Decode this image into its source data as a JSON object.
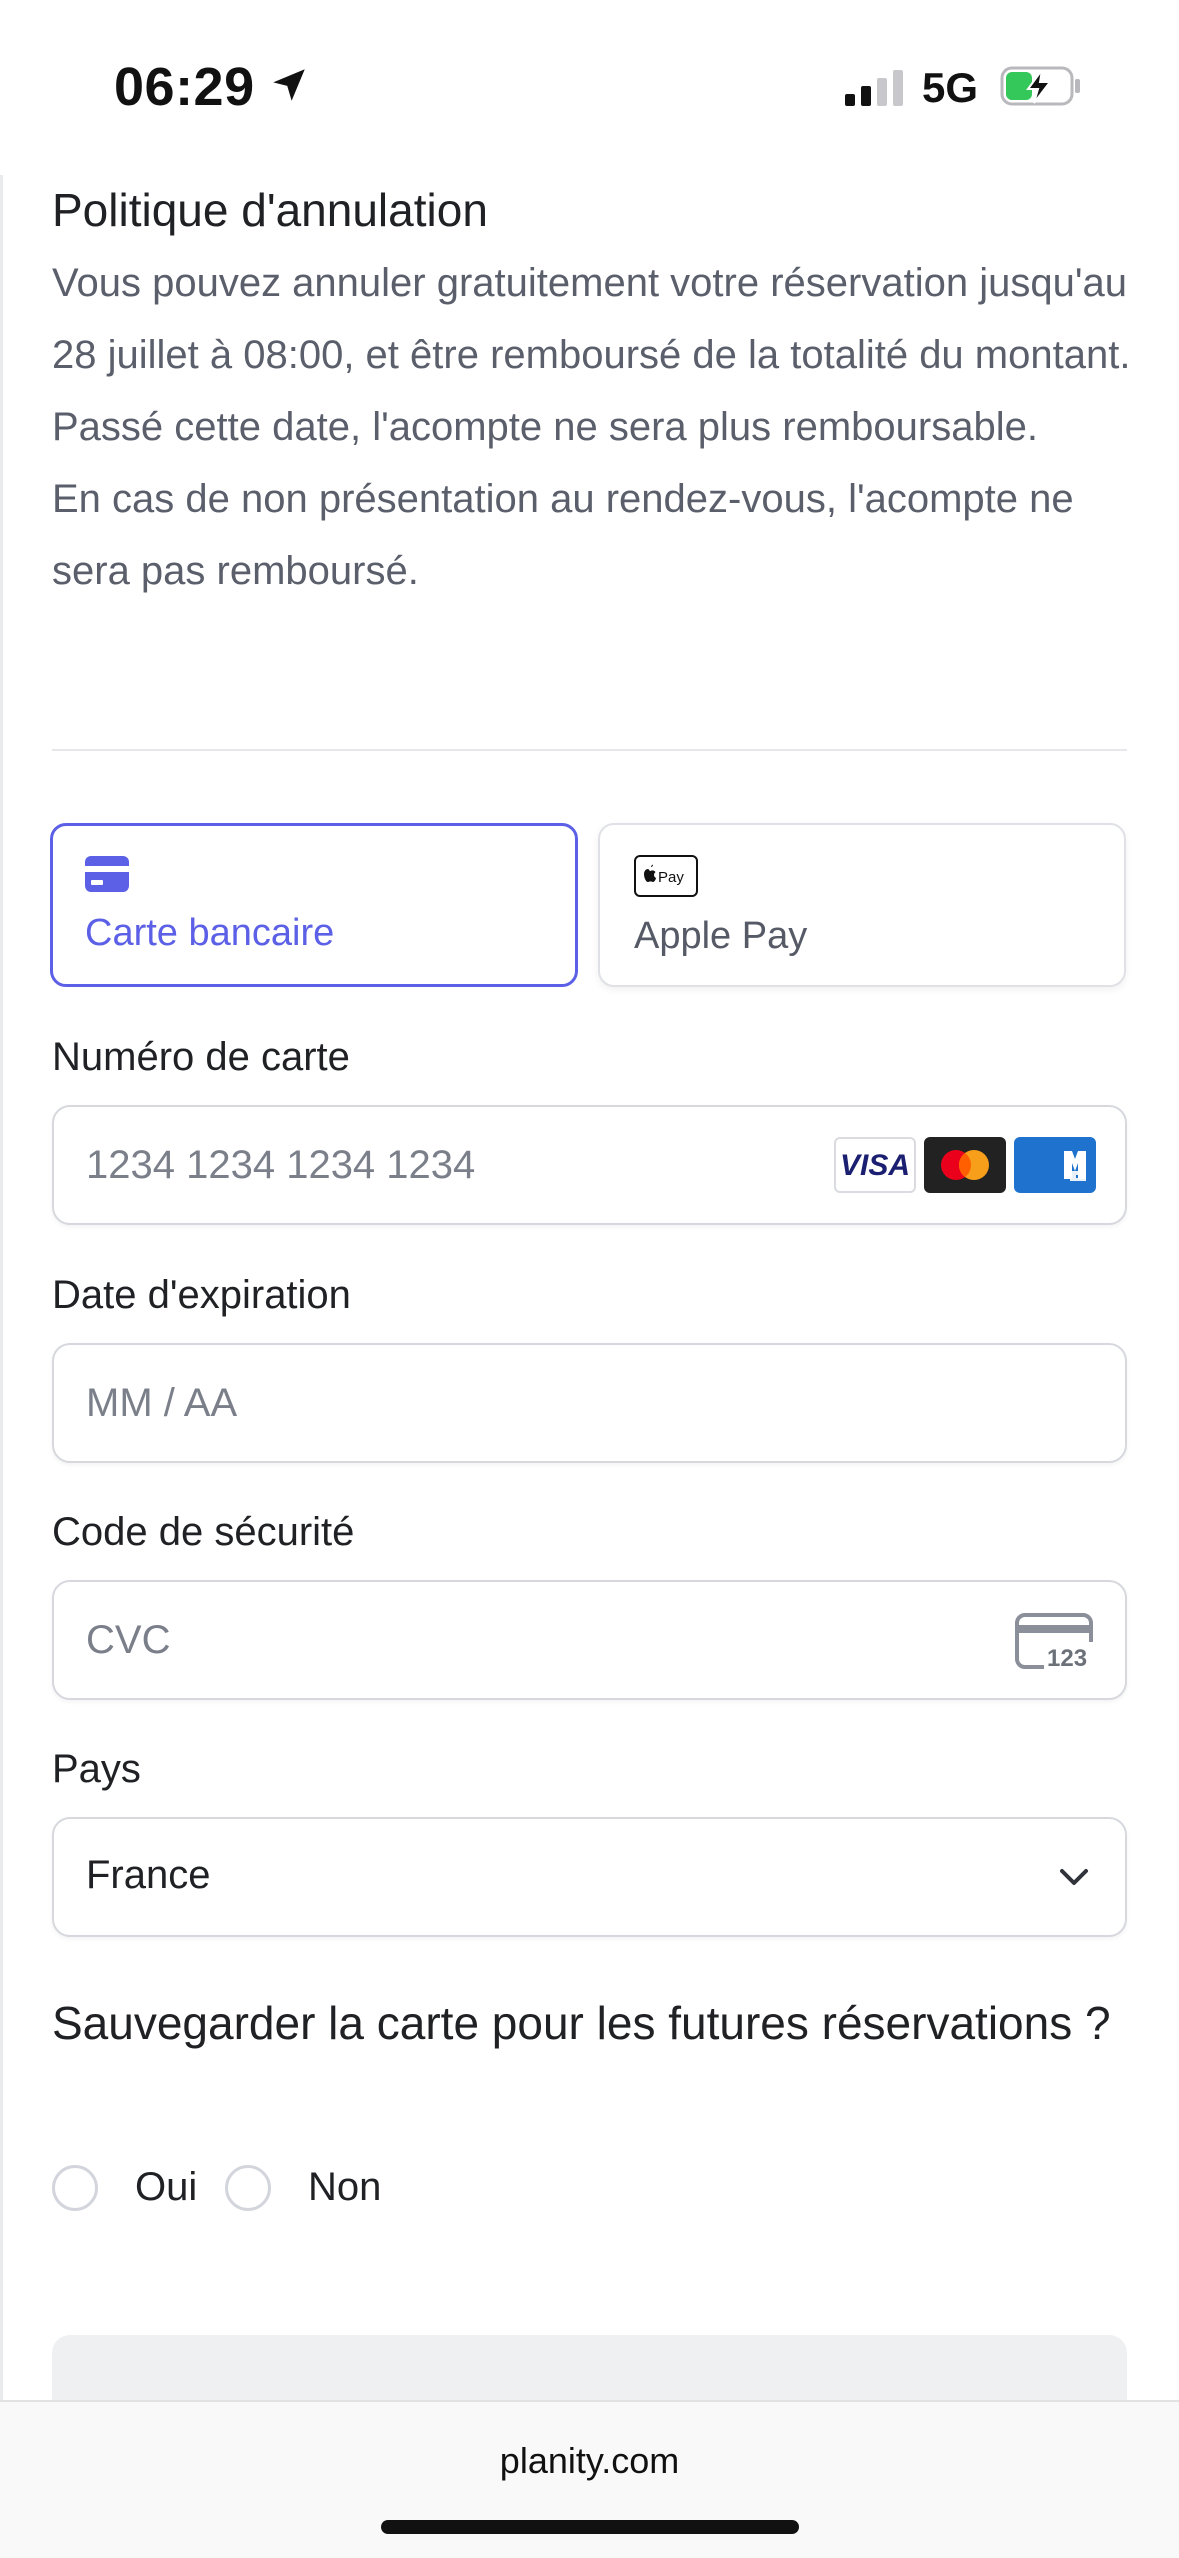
{
  "status_bar": {
    "time": "06:29",
    "network": "5G",
    "icons": [
      "location-arrow-icon",
      "signal-icon",
      "battery-charging-icon"
    ]
  },
  "policy": {
    "title": "Politique d'annulation",
    "paragraph1": "Vous pouvez annuler gratuitement votre réservation jusqu'au 28 juillet à 08:00, et être remboursé de la totalité du montant. Passé cette date, l'acompte ne sera plus remboursable.",
    "paragraph2": "En cas de non présentation au rendez-vous, l'acompte ne sera pas remboursé."
  },
  "payment_methods": {
    "card_label": "Carte bancaire",
    "apple_pay_label": "Apple Pay",
    "apple_pay_badge": "Pay",
    "selected": "Carte bancaire"
  },
  "form": {
    "card_number": {
      "label": "Numéro de carte",
      "placeholder": "1234 1234 1234 1234",
      "brands": [
        "VISA",
        "Mastercard",
        "American Express"
      ]
    },
    "expiry": {
      "label": "Date d'expiration",
      "placeholder": "MM / AA"
    },
    "cvc": {
      "label": "Code de sécurité",
      "placeholder": "CVC",
      "icon_text": "123"
    },
    "country": {
      "label": "Pays",
      "value": "France"
    }
  },
  "save_card": {
    "question": "Sauvegarder la carte pour les futures réservations ?",
    "options": [
      "Oui",
      "Non"
    ]
  },
  "browser": {
    "url": "planity.com"
  },
  "colors": {
    "accent": "#5c60e6",
    "text": "#202125",
    "muted": "#5a5f6b",
    "border": "#d6d8de"
  }
}
